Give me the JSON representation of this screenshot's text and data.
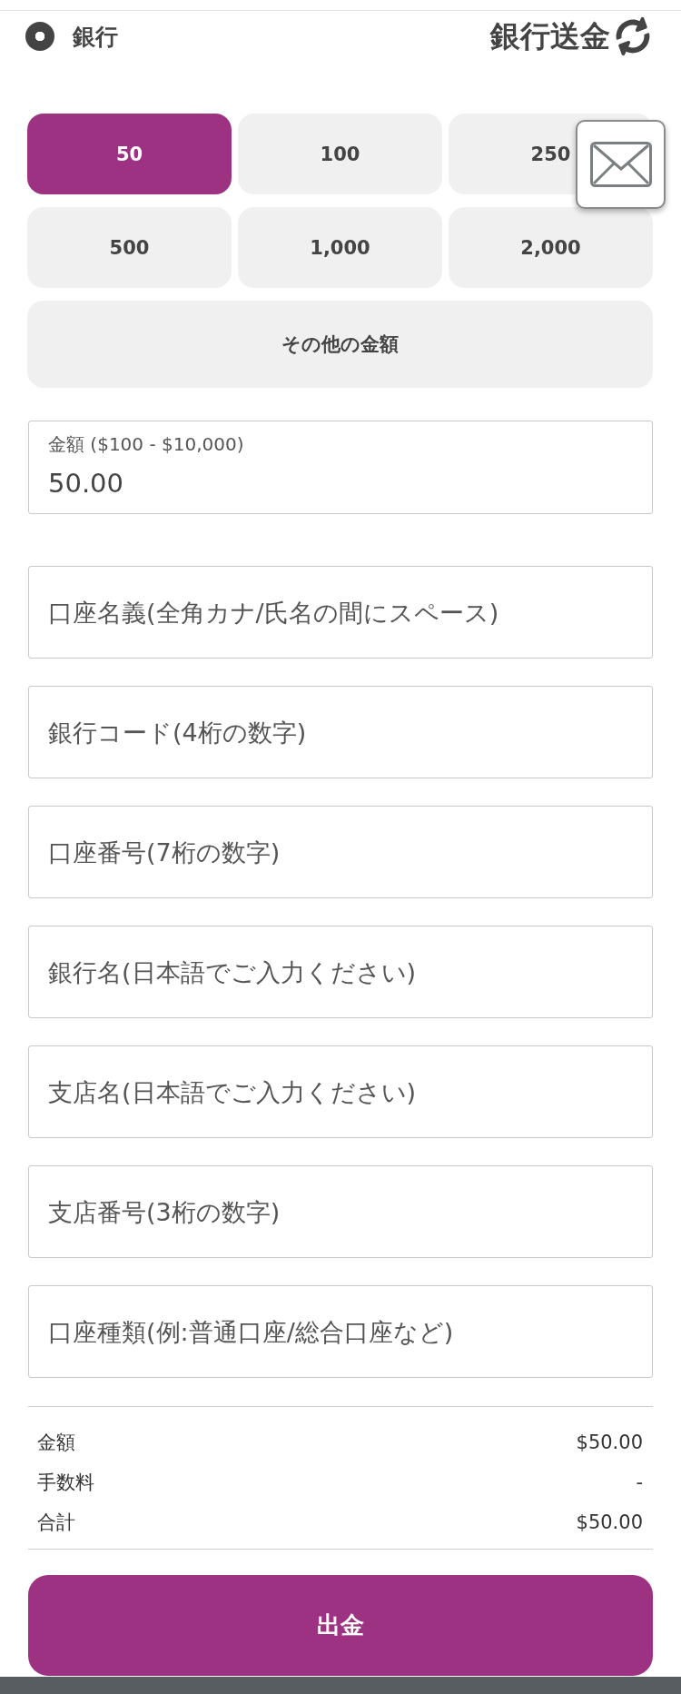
{
  "payment_method": {
    "label": "銀行",
    "selected": true
  },
  "title": "銀行送金",
  "amount_options": [
    {
      "label": "50",
      "selected": true
    },
    {
      "label": "100",
      "selected": false
    },
    {
      "label": "250",
      "selected": false
    },
    {
      "label": "500",
      "selected": false
    },
    {
      "label": "1,000",
      "selected": false
    },
    {
      "label": "2,000",
      "selected": false
    }
  ],
  "other_amount": {
    "label": "その他の金額",
    "selected": false
  },
  "amount_field": {
    "label": "金額 ($100 - $10,000)",
    "value": "50.00"
  },
  "bank_fields": [
    {
      "placeholder": "口座名義(全角カナ/氏名の間にスペース)"
    },
    {
      "placeholder": "銀行コード(4桁の数字)"
    },
    {
      "placeholder": "口座番号(7桁の数字)"
    },
    {
      "placeholder": "銀行名(日本語でご入力ください)"
    },
    {
      "placeholder": "支店名(日本語でご入力ください)"
    },
    {
      "placeholder": "支店番号(3桁の数字)"
    },
    {
      "placeholder": "口座種類(例:普通口座/総合口座など)"
    }
  ],
  "summary": [
    {
      "label": "金額",
      "value": "$50.00"
    },
    {
      "label": "手数料",
      "value": "-"
    },
    {
      "label": "合計",
      "value": "$50.00"
    }
  ],
  "submit_button": {
    "label": "出金"
  }
}
